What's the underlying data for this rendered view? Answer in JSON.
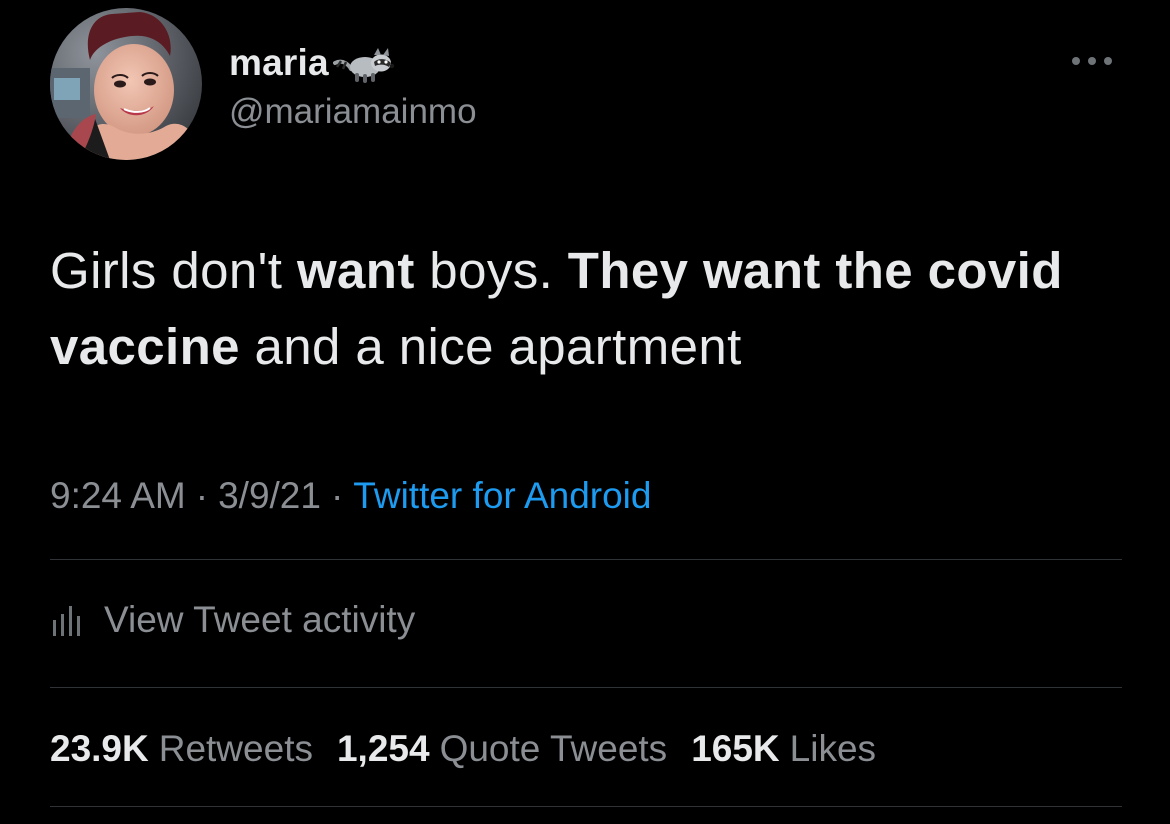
{
  "theme": {
    "background": "#000000",
    "text_primary": "#e7e9ea",
    "text_secondary": "#8b8f94",
    "accent_link": "#1d9bf0",
    "divider": "#2f3336"
  },
  "author": {
    "display_name": "maria",
    "name_emoji_icon": "raccoon-icon",
    "handle": "@mariamainmo",
    "avatar_icon": "profile-photo"
  },
  "more_icon": "more-horizontal-icon",
  "tweet": {
    "segments": [
      {
        "text": "Girls don't ",
        "bold": false
      },
      {
        "text": "want",
        "bold": true
      },
      {
        "text": " boys. ",
        "bold": false
      },
      {
        "text": "They want the covid vaccine",
        "bold": true
      },
      {
        "text": " and a nice apartment",
        "bold": false
      }
    ]
  },
  "meta": {
    "time": "9:24 AM",
    "separator": "·",
    "date": "3/9/21",
    "source": "Twitter for Android"
  },
  "activity": {
    "icon": "bar-chart-icon",
    "label": "View Tweet activity"
  },
  "stats": {
    "retweets": {
      "count": "23.9K",
      "label": "Retweets"
    },
    "quote_tweets": {
      "count": "1,254",
      "label": "Quote Tweets"
    },
    "likes": {
      "count": "165K",
      "label": "Likes"
    }
  }
}
